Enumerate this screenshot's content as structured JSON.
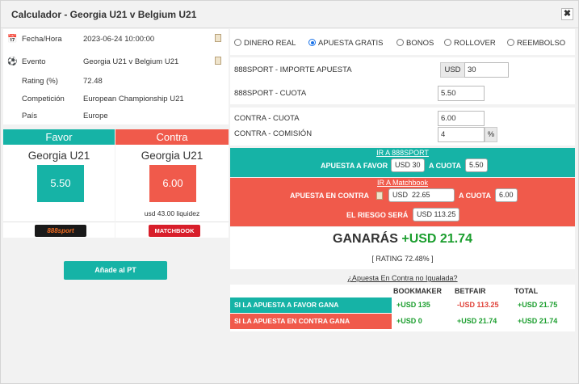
{
  "window": {
    "title": "Calculador - Georgia U21 v Belgium U21",
    "close_label": "✖"
  },
  "info": [
    {
      "icon": "calendar-icon",
      "label": "Fecha/Hora",
      "value": "2023-06-24 10:00:00"
    },
    {
      "icon": "football-icon",
      "label": "Evento",
      "value": "Georgia U21 v Belgium U21"
    },
    {
      "icon": "",
      "label": "Rating (%)",
      "value": "72.48"
    },
    {
      "icon": "",
      "label": "Competición",
      "value": "European Championship U21"
    },
    {
      "icon": "",
      "label": "País",
      "value": "Europe"
    }
  ],
  "favor": {
    "header": "Favor",
    "team": "Georgia U21",
    "odds": "5.50",
    "bookmaker_logo": "888sport"
  },
  "contra": {
    "header": "Contra",
    "team": "Georgia U21",
    "odds": "6.00",
    "liquidity": "usd 43.00 liquidez",
    "exchange_logo": "MATCHBOOK"
  },
  "add_button": "Añade al PT",
  "bet_types": [
    {
      "label": "DINERO REAL",
      "selected": false
    },
    {
      "label": "APUESTA GRATIS",
      "selected": true
    },
    {
      "label": "BONOS",
      "selected": false
    },
    {
      "label": "ROLLOVER",
      "selected": false
    },
    {
      "label": "REEMBOLSO",
      "selected": false
    }
  ],
  "stake": {
    "label": "888SPORT - IMPORTE APUESTA",
    "currency": "USD",
    "value": "30"
  },
  "back_odds": {
    "label": "888SPORT - CUOTA",
    "value": "5.50"
  },
  "lay_odds": {
    "label": "CONTRA - CUOTA",
    "value": "6.00"
  },
  "commission": {
    "label": "CONTRA - COMISIÓN",
    "value": "4",
    "unit": "%"
  },
  "favor_bar": {
    "link": "IR A 888SPORT",
    "text1": "APUESTA A FAVOR",
    "amount": "USD 30",
    "text2": "A CUOTA",
    "odds": "5.50"
  },
  "contra_bar": {
    "link": "IR A Matchbook",
    "text1": "APUESTA EN CONTRA",
    "amount_currency": "USD",
    "amount": "22.65",
    "text2": "A CUOTA",
    "odds": "6.00",
    "risk_label": "EL RIESGO SERÁ",
    "risk": "USD 113.25"
  },
  "result": {
    "label": "GANARÁS",
    "amount": "+USD 21.74",
    "rating": "[ RATING 72.48% ]"
  },
  "unmatched_link": "¿Apuesta En Contra no Igualada?",
  "table": {
    "headers": [
      "BOOKMAKER",
      "BETFAIR",
      "TOTAL"
    ],
    "rows": [
      {
        "label": "SI LA APUESTA A FAVOR GANA",
        "bookmaker": "+USD 135",
        "betfair": "-USD 113.25",
        "total": "+USD 21.75"
      },
      {
        "label": "SI LA APUESTA EN CONTRA GANA",
        "bookmaker": "+USD 0",
        "betfair": "+USD 21.74",
        "total": "+USD 21.74"
      }
    ]
  },
  "colors": {
    "favor": "#16b3a6",
    "contra": "#f05a4b",
    "positive": "#1b9e2e",
    "negative": "#e0433a"
  }
}
